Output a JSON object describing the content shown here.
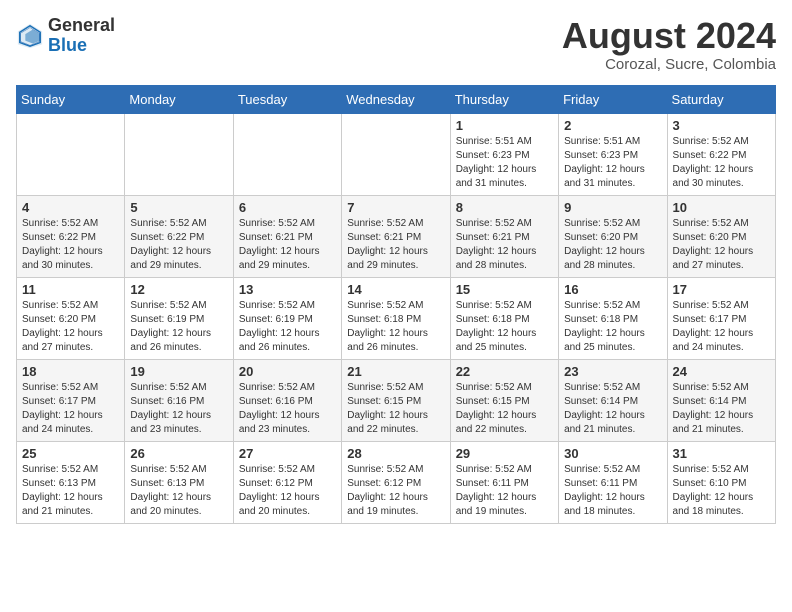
{
  "header": {
    "logo_general": "General",
    "logo_blue": "Blue",
    "month_year": "August 2024",
    "location": "Corozal, Sucre, Colombia"
  },
  "days_of_week": [
    "Sunday",
    "Monday",
    "Tuesday",
    "Wednesday",
    "Thursday",
    "Friday",
    "Saturday"
  ],
  "weeks": [
    [
      {
        "day": "",
        "info": ""
      },
      {
        "day": "",
        "info": ""
      },
      {
        "day": "",
        "info": ""
      },
      {
        "day": "",
        "info": ""
      },
      {
        "day": "1",
        "info": "Sunrise: 5:51 AM\nSunset: 6:23 PM\nDaylight: 12 hours\nand 31 minutes."
      },
      {
        "day": "2",
        "info": "Sunrise: 5:51 AM\nSunset: 6:23 PM\nDaylight: 12 hours\nand 31 minutes."
      },
      {
        "day": "3",
        "info": "Sunrise: 5:52 AM\nSunset: 6:22 PM\nDaylight: 12 hours\nand 30 minutes."
      }
    ],
    [
      {
        "day": "4",
        "info": "Sunrise: 5:52 AM\nSunset: 6:22 PM\nDaylight: 12 hours\nand 30 minutes."
      },
      {
        "day": "5",
        "info": "Sunrise: 5:52 AM\nSunset: 6:22 PM\nDaylight: 12 hours\nand 29 minutes."
      },
      {
        "day": "6",
        "info": "Sunrise: 5:52 AM\nSunset: 6:21 PM\nDaylight: 12 hours\nand 29 minutes."
      },
      {
        "day": "7",
        "info": "Sunrise: 5:52 AM\nSunset: 6:21 PM\nDaylight: 12 hours\nand 29 minutes."
      },
      {
        "day": "8",
        "info": "Sunrise: 5:52 AM\nSunset: 6:21 PM\nDaylight: 12 hours\nand 28 minutes."
      },
      {
        "day": "9",
        "info": "Sunrise: 5:52 AM\nSunset: 6:20 PM\nDaylight: 12 hours\nand 28 minutes."
      },
      {
        "day": "10",
        "info": "Sunrise: 5:52 AM\nSunset: 6:20 PM\nDaylight: 12 hours\nand 27 minutes."
      }
    ],
    [
      {
        "day": "11",
        "info": "Sunrise: 5:52 AM\nSunset: 6:20 PM\nDaylight: 12 hours\nand 27 minutes."
      },
      {
        "day": "12",
        "info": "Sunrise: 5:52 AM\nSunset: 6:19 PM\nDaylight: 12 hours\nand 26 minutes."
      },
      {
        "day": "13",
        "info": "Sunrise: 5:52 AM\nSunset: 6:19 PM\nDaylight: 12 hours\nand 26 minutes."
      },
      {
        "day": "14",
        "info": "Sunrise: 5:52 AM\nSunset: 6:18 PM\nDaylight: 12 hours\nand 26 minutes."
      },
      {
        "day": "15",
        "info": "Sunrise: 5:52 AM\nSunset: 6:18 PM\nDaylight: 12 hours\nand 25 minutes."
      },
      {
        "day": "16",
        "info": "Sunrise: 5:52 AM\nSunset: 6:18 PM\nDaylight: 12 hours\nand 25 minutes."
      },
      {
        "day": "17",
        "info": "Sunrise: 5:52 AM\nSunset: 6:17 PM\nDaylight: 12 hours\nand 24 minutes."
      }
    ],
    [
      {
        "day": "18",
        "info": "Sunrise: 5:52 AM\nSunset: 6:17 PM\nDaylight: 12 hours\nand 24 minutes."
      },
      {
        "day": "19",
        "info": "Sunrise: 5:52 AM\nSunset: 6:16 PM\nDaylight: 12 hours\nand 23 minutes."
      },
      {
        "day": "20",
        "info": "Sunrise: 5:52 AM\nSunset: 6:16 PM\nDaylight: 12 hours\nand 23 minutes."
      },
      {
        "day": "21",
        "info": "Sunrise: 5:52 AM\nSunset: 6:15 PM\nDaylight: 12 hours\nand 22 minutes."
      },
      {
        "day": "22",
        "info": "Sunrise: 5:52 AM\nSunset: 6:15 PM\nDaylight: 12 hours\nand 22 minutes."
      },
      {
        "day": "23",
        "info": "Sunrise: 5:52 AM\nSunset: 6:14 PM\nDaylight: 12 hours\nand 21 minutes."
      },
      {
        "day": "24",
        "info": "Sunrise: 5:52 AM\nSunset: 6:14 PM\nDaylight: 12 hours\nand 21 minutes."
      }
    ],
    [
      {
        "day": "25",
        "info": "Sunrise: 5:52 AM\nSunset: 6:13 PM\nDaylight: 12 hours\nand 21 minutes."
      },
      {
        "day": "26",
        "info": "Sunrise: 5:52 AM\nSunset: 6:13 PM\nDaylight: 12 hours\nand 20 minutes."
      },
      {
        "day": "27",
        "info": "Sunrise: 5:52 AM\nSunset: 6:12 PM\nDaylight: 12 hours\nand 20 minutes."
      },
      {
        "day": "28",
        "info": "Sunrise: 5:52 AM\nSunset: 6:12 PM\nDaylight: 12 hours\nand 19 minutes."
      },
      {
        "day": "29",
        "info": "Sunrise: 5:52 AM\nSunset: 6:11 PM\nDaylight: 12 hours\nand 19 minutes."
      },
      {
        "day": "30",
        "info": "Sunrise: 5:52 AM\nSunset: 6:11 PM\nDaylight: 12 hours\nand 18 minutes."
      },
      {
        "day": "31",
        "info": "Sunrise: 5:52 AM\nSunset: 6:10 PM\nDaylight: 12 hours\nand 18 minutes."
      }
    ]
  ]
}
